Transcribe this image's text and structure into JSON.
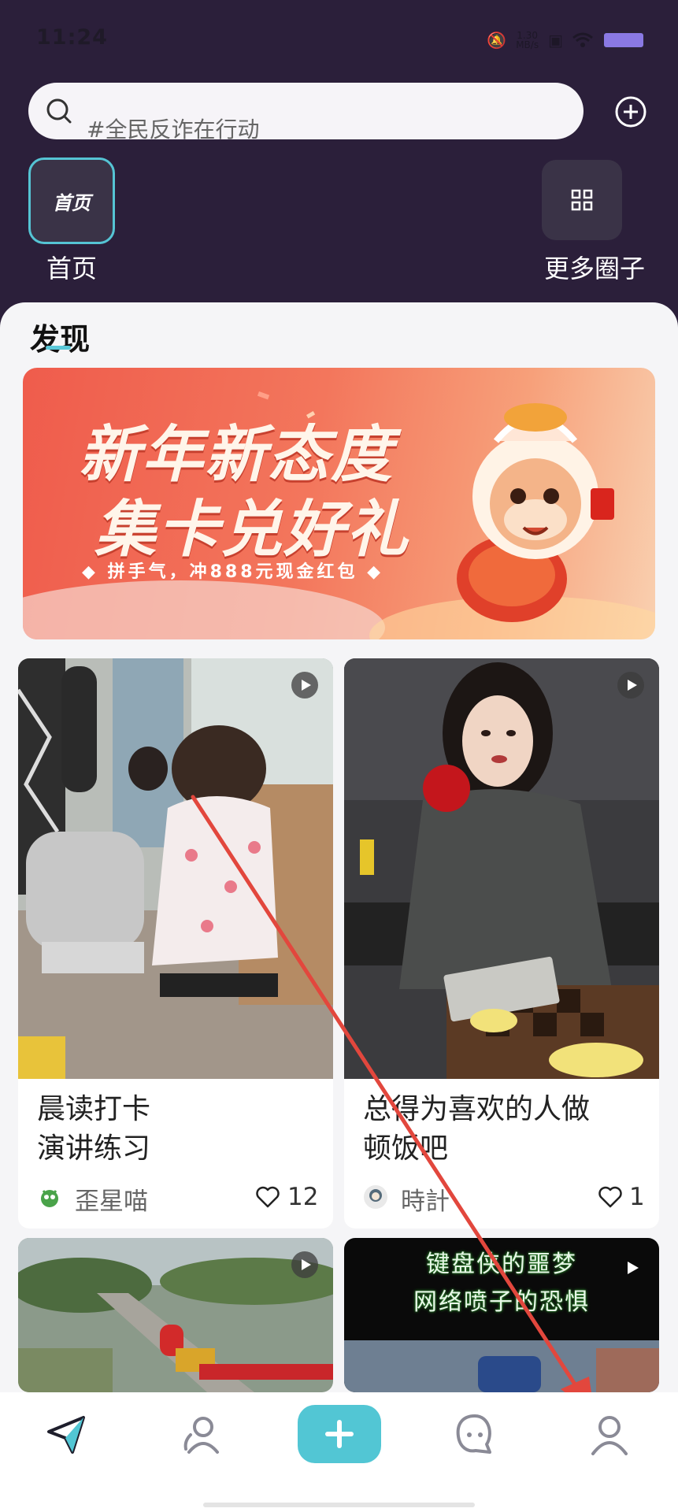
{
  "status_bar": {
    "time": "11:24",
    "net_speed": "1.30",
    "net_unit": "MB/s"
  },
  "header": {
    "search_placeholder": "#全民反诈在行动",
    "home_tile_text": "首页",
    "home_label": "首页",
    "more_label": "更多圈子"
  },
  "section": {
    "title": "发现"
  },
  "banner": {
    "line1": "新年新态度",
    "line2": "集卡兑好礼",
    "subtitle": "◆ 拼手气，冲888元现金红包 ◆"
  },
  "cards": [
    {
      "title_line1": "晨读打卡",
      "title_line2": "演讲练习",
      "author": "歪星喵",
      "likes": "12"
    },
    {
      "title_line1": "总得为喜欢的人做",
      "title_line2": "顿饭吧",
      "author": "時計",
      "likes": "1"
    },
    {
      "overlay_line1": "",
      "overlay_line2": ""
    },
    {
      "overlay_line1": "键盘侠的噩梦",
      "overlay_line2": "网络喷子的恐惧"
    }
  ],
  "bottom_nav": [
    "discover-icon",
    "friends-icon",
    "plus-icon",
    "chat-icon",
    "profile-icon"
  ],
  "colors": {
    "header_bg": "#2b1f3a",
    "accent": "#52c6d4",
    "banner": "#ef5c4c"
  }
}
